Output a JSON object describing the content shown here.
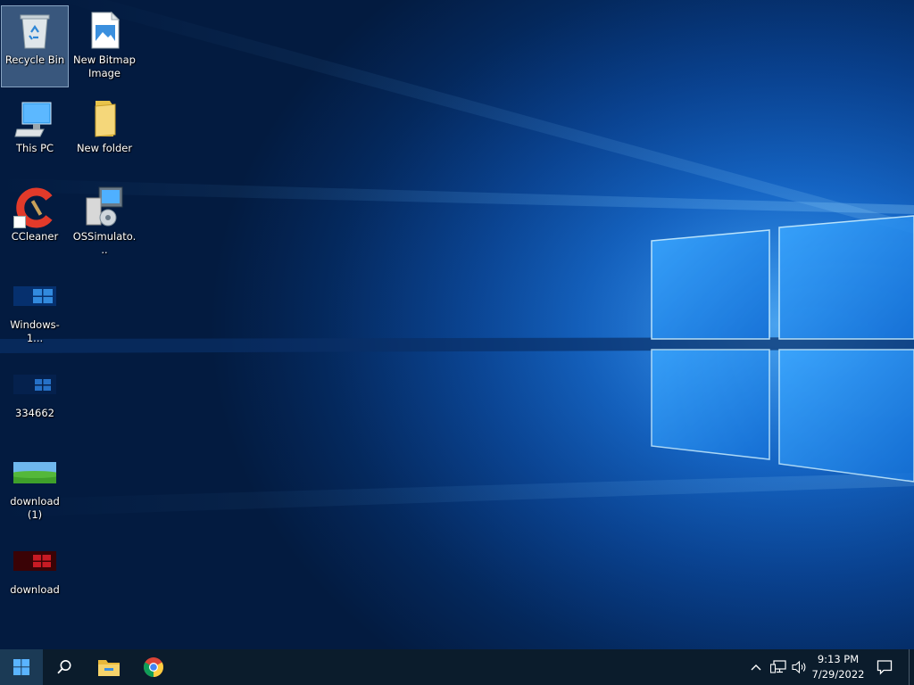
{
  "desktop": {
    "icons": [
      {
        "label": "Recycle Bin",
        "icon": "recycle-bin-icon",
        "selected": true
      },
      {
        "label": "New Bitmap Image",
        "icon": "bitmap-image-icon"
      },
      {
        "label": "This PC",
        "icon": "this-pc-icon"
      },
      {
        "label": "New folder",
        "icon": "folder-icon"
      },
      {
        "label": "CCleaner",
        "icon": "ccleaner-icon"
      },
      {
        "label": "OSSimulato...",
        "icon": "installer-icon"
      },
      {
        "label": "Windows-1...",
        "icon": "image-thumbnail-icon"
      },
      {
        "label": "334662",
        "icon": "image-thumbnail-icon"
      },
      {
        "label": "download (1)",
        "icon": "image-thumbnail-icon"
      },
      {
        "label": "download",
        "icon": "image-thumbnail-icon"
      }
    ]
  },
  "taskbar": {
    "start_icon": "windows-logo-icon",
    "search_icon": "search-icon",
    "pinned": [
      {
        "name": "File Explorer",
        "icon": "folder-icon"
      },
      {
        "name": "Google Chrome",
        "icon": "chrome-icon"
      }
    ],
    "tray": {
      "chevron_icon": "chevron-up-icon",
      "network_icon": "network-icon",
      "volume_icon": "volume-icon"
    },
    "clock": {
      "time": "9:13 PM",
      "date": "7/29/2022"
    },
    "notification_icon": "notification-icon"
  },
  "colors": {
    "accent": "#1b7fe6",
    "taskbar": "#0b1c2c",
    "wallpaper_dark": "#031b40"
  }
}
